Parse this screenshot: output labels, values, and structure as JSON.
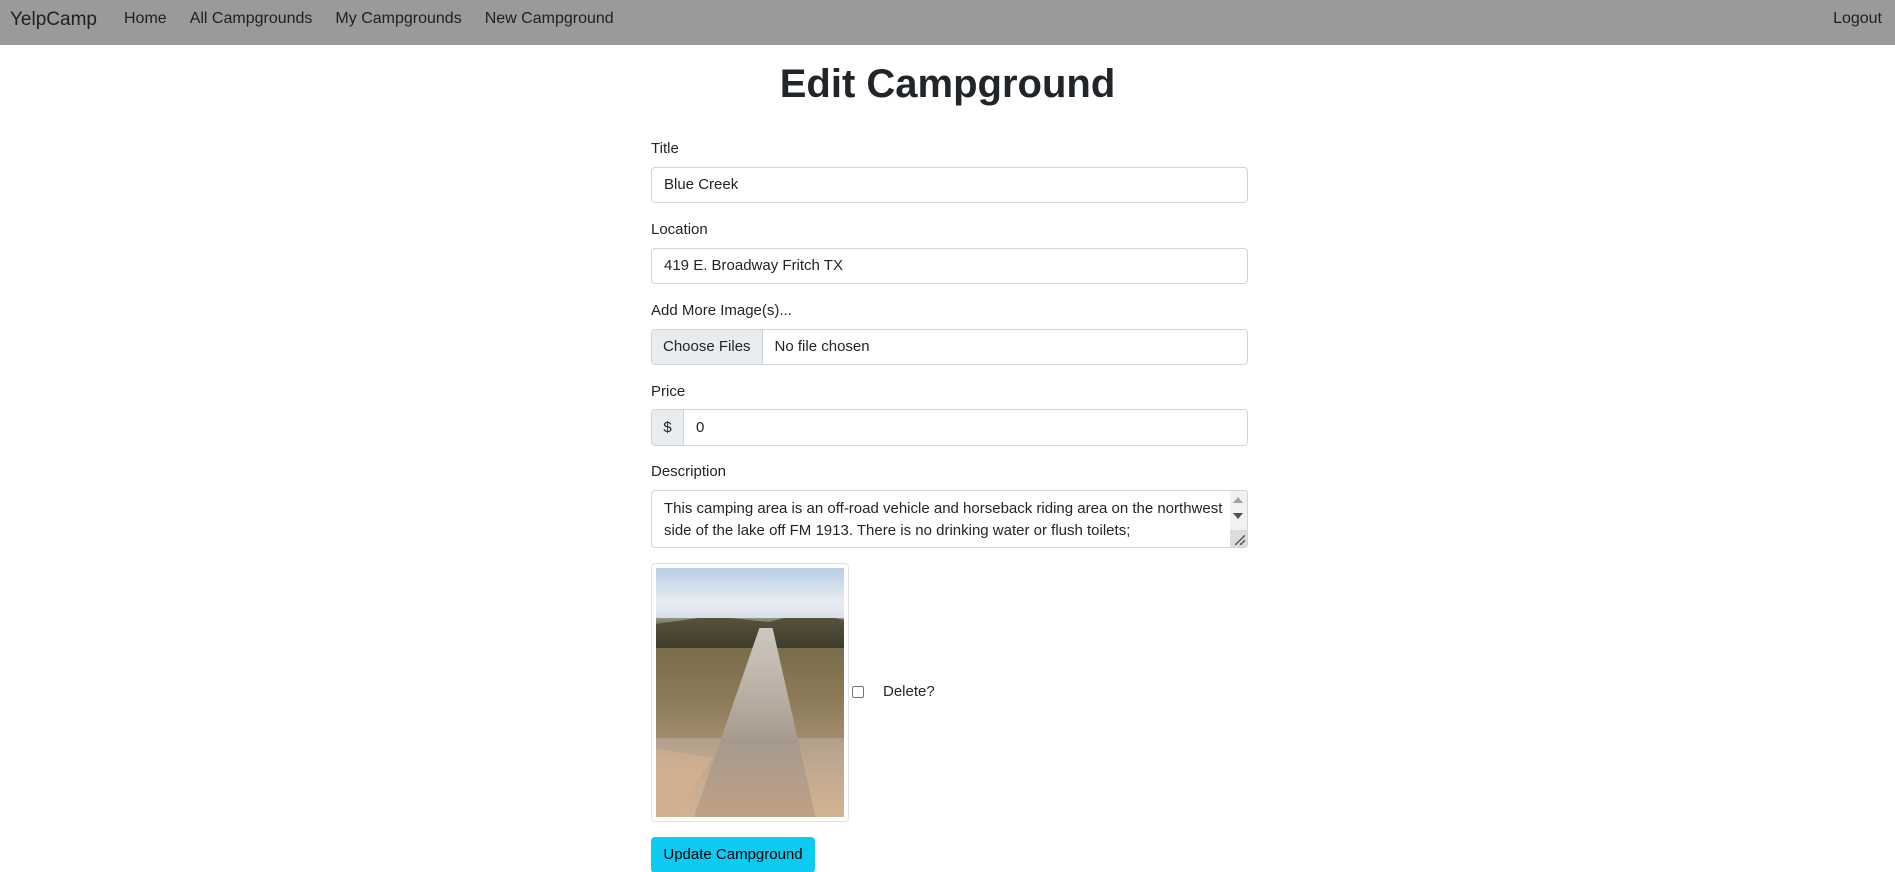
{
  "navbar": {
    "brand": "YelpCamp",
    "links": [
      "Home",
      "All Campgrounds",
      "My Campgrounds",
      "New Campground"
    ],
    "logout": "Logout"
  },
  "page": {
    "title": "Edit Campground"
  },
  "form": {
    "title_label": "Title",
    "title_value": "Blue Creek",
    "location_label": "Location",
    "location_value": "419 E. Broadway Fritch TX",
    "images_label": "Add More Image(s)...",
    "choose_files": "Choose Files",
    "no_file": "No file chosen",
    "price_label": "Price",
    "price_prefix": "$",
    "price_value": "0",
    "description_label": "Description",
    "description_value": "This camping area is an off-road vehicle and horseback riding area on the northwest side of the lake off FM 1913. There is no drinking water or flush toilets;",
    "delete_label": "Delete?",
    "submit_label": "Update Campground"
  }
}
